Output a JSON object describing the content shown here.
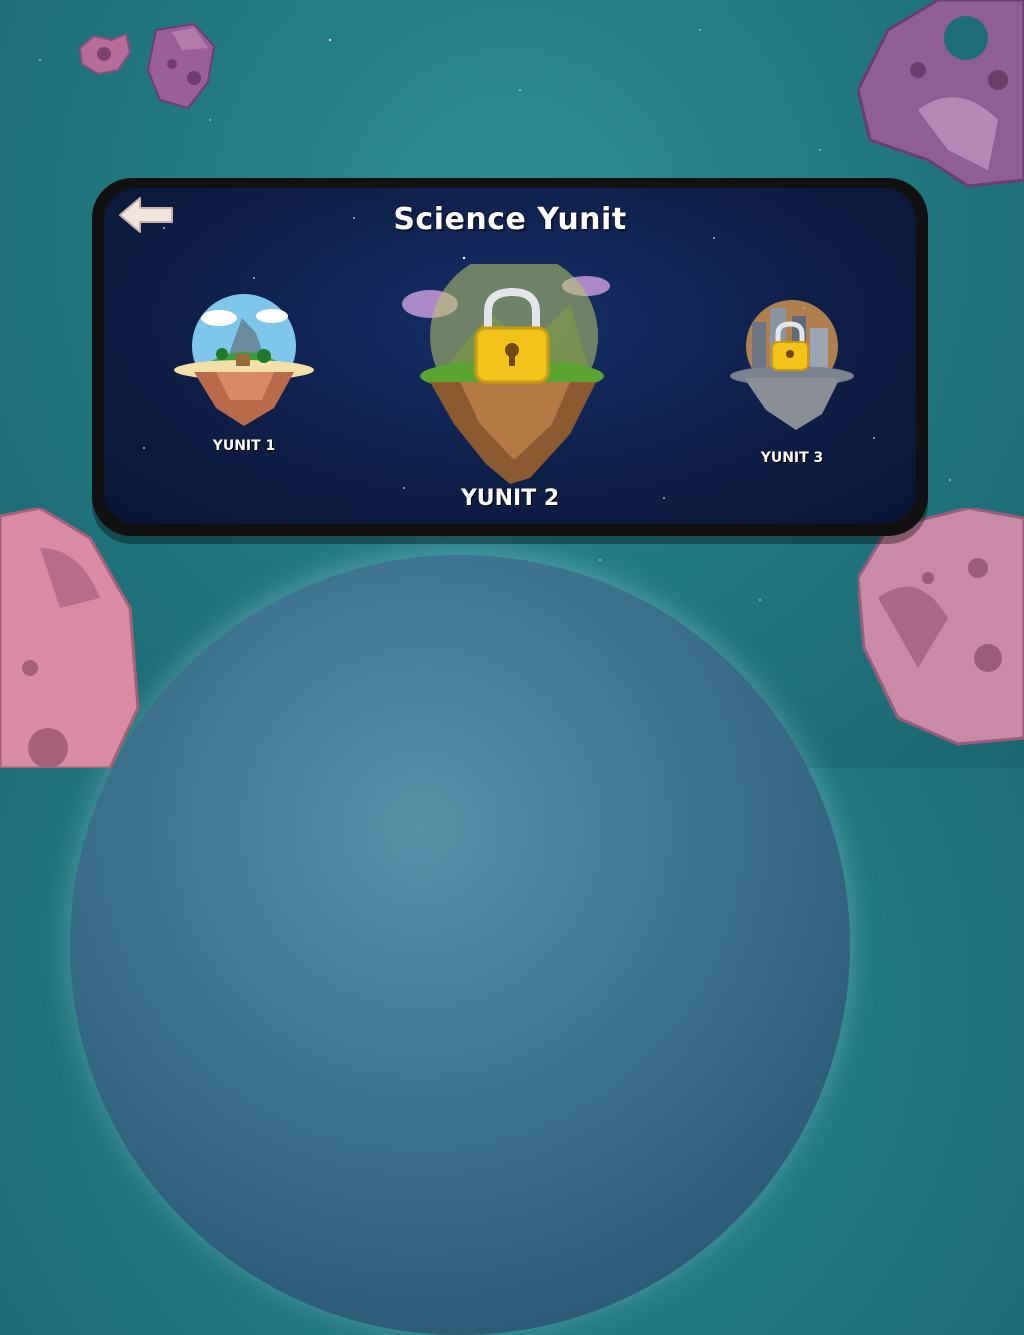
{
  "screen": {
    "title": "Science Yunit"
  },
  "units": [
    {
      "label": "YUNIT 1",
      "locked": false
    },
    {
      "label": "YUNIT 2",
      "locked": true
    },
    {
      "label": "YUNIT 3",
      "locked": true
    }
  ],
  "colors": {
    "background": "#237a82",
    "panel_bg": "#0e1f48",
    "lock_gold": "#f2c31b",
    "asteroid_pink": "#c98aa8",
    "asteroid_purple": "#8c5a8e"
  }
}
